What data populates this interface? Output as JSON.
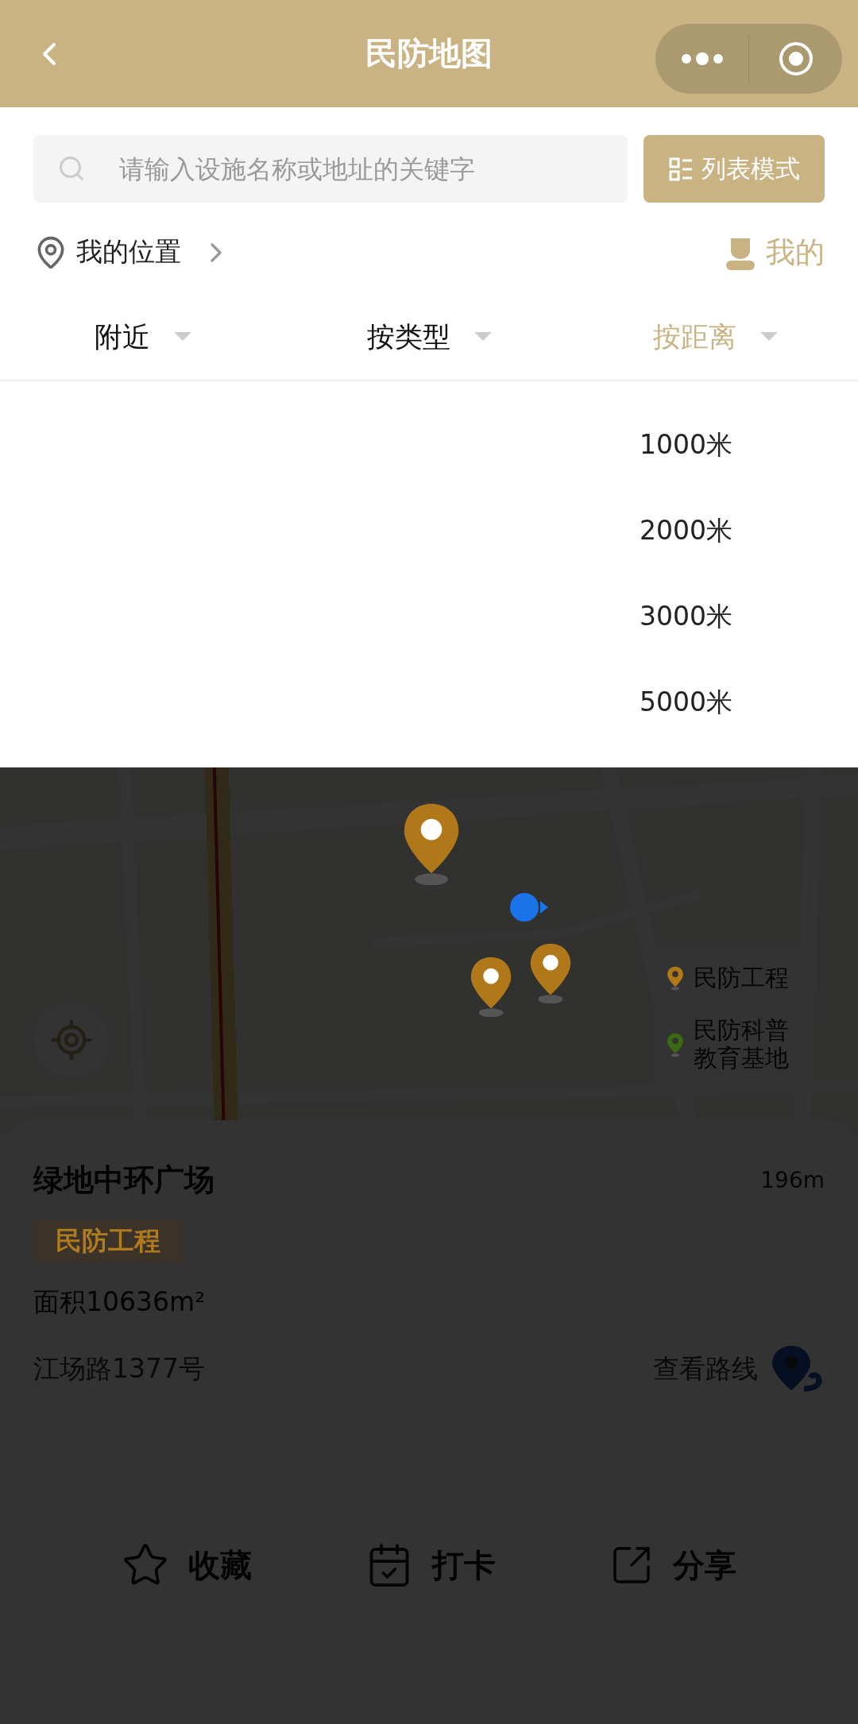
{
  "header": {
    "title": "民防地图"
  },
  "search": {
    "placeholder": "请输入设施名称或地址的关键字"
  },
  "list_mode_button": {
    "label": "列表模式"
  },
  "location": {
    "label": "我的位置"
  },
  "mine_link": {
    "label": "我的"
  },
  "filters": [
    {
      "label": "附近",
      "selected": false
    },
    {
      "label": "按类型",
      "selected": false
    },
    {
      "label": "按距离",
      "selected": true
    }
  ],
  "distance_options": [
    {
      "label": "1000米",
      "selected": false
    },
    {
      "label": "2000米",
      "selected": false
    },
    {
      "label": "3000米",
      "selected": false
    },
    {
      "label": "5000米",
      "selected": false
    }
  ],
  "legend": [
    {
      "label": "民防工程",
      "color": "#b07818"
    },
    {
      "label": "民防科普教育基地",
      "color": "#3a6b12"
    }
  ],
  "place": {
    "name": "绿地中环广场",
    "distance": "196m",
    "tag": "民防工程",
    "area": "面积10636m²",
    "address": "江场路1377号",
    "route_label": "查看路线"
  },
  "actions": [
    {
      "label": "收藏",
      "kind": "star"
    },
    {
      "label": "打卡",
      "kind": "checkin"
    },
    {
      "label": "分享",
      "kind": "share"
    }
  ]
}
